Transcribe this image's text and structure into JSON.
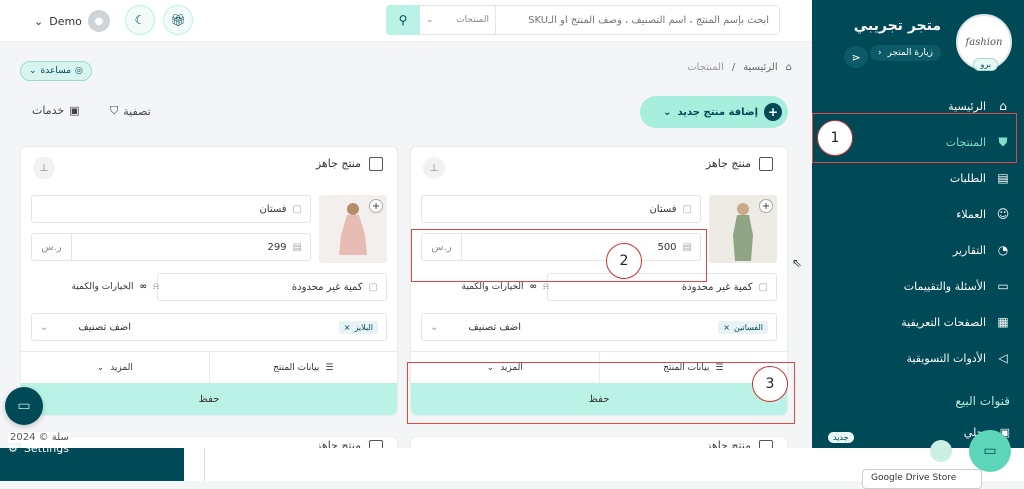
{
  "header": {
    "user_name": "Demo",
    "search_placeholder": "ابحث بإسم المنتج ، اسم التصنيف ، وصف المنتج أو الـSKU",
    "search_scope": "المنتجات"
  },
  "sidebar": {
    "store_name": "متجر تجريبي",
    "visit_store": "زيارة المتجر",
    "pro_badge": "برو",
    "logo_text": "fashion",
    "items": [
      {
        "label": "الرئيسية",
        "icon": "home-icon"
      },
      {
        "label": "المنتجات",
        "icon": "shirt-icon"
      },
      {
        "label": "الطلبات",
        "icon": "orders-icon"
      },
      {
        "label": "العملاء",
        "icon": "customers-icon"
      },
      {
        "label": "التقارير",
        "icon": "pie-chart-icon"
      },
      {
        "label": "الأسئلة والتقييمات",
        "icon": "chat-icon"
      },
      {
        "label": "الصفحات التعريفية",
        "icon": "pages-icon"
      },
      {
        "label": "الأدوات التسويقية",
        "icon": "megaphone-icon"
      }
    ],
    "sales_channels_label": "قنوات البيع",
    "local_label": "محلي",
    "new_badge": "جديد",
    "settings_label": "Settings"
  },
  "page": {
    "help_label": "مساعدة",
    "breadcrumb_home": "الرئيسية",
    "breadcrumb_sep": "/",
    "breadcrumb_current": "المنتجات",
    "add_product_label": "إضافة منتج جديد",
    "filter_label": "تصفية",
    "services_label": "خدمات",
    "copyright": "سلة © 2024",
    "bottom_button_text": "Google Drive Store"
  },
  "products": [
    {
      "title": "منتج جاهز",
      "name": "فستان",
      "price": "500",
      "currency": "ر.س",
      "quantity": "كمية غير محدودة",
      "options_label": "الخيارات والكمية",
      "category_tag": "الفساتين",
      "category_placeholder": "اضف تصنيف",
      "product_data_label": "بيانات المنتج",
      "more_label": "المزيد",
      "save_label": "حفظ"
    },
    {
      "title": "منتج جاهز",
      "name": "فستان",
      "price": "299",
      "currency": "ر.س",
      "quantity": "كمية غير محدودة",
      "options_label": "الخيارات والكمية",
      "category_tag": "البلايز",
      "category_placeholder": "اضف تصنيف",
      "product_data_label": "بيانات المنتج",
      "more_label": "المزيد",
      "save_label": "حفظ"
    }
  ],
  "next_row_title": "منتج جاهز",
  "annotations": [
    "1",
    "2",
    "3"
  ]
}
